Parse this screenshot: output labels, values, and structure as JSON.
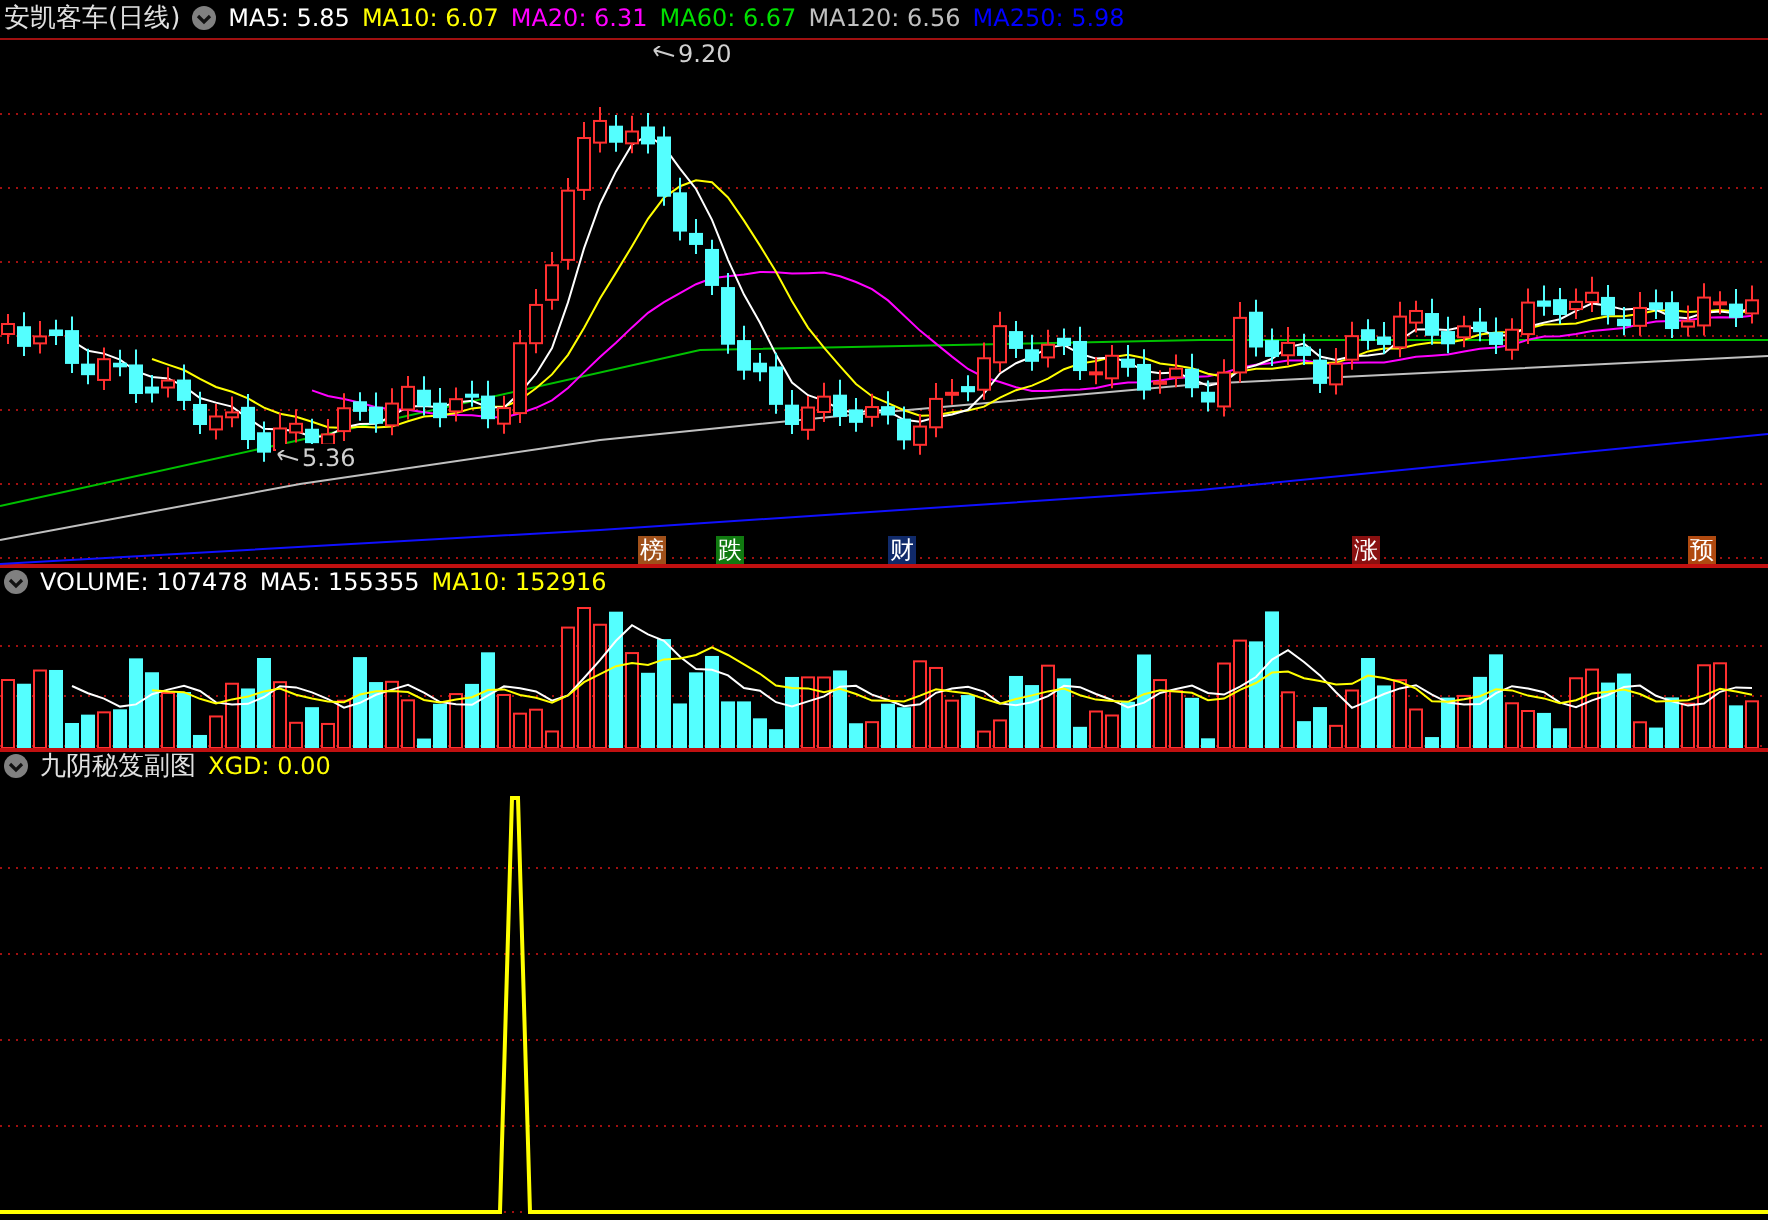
{
  "price_panel": {
    "title": "安凯客车(日线)",
    "legend": [
      {
        "label": "MA5: 5.85",
        "color": "#ffffff"
      },
      {
        "label": "MA10: 6.07",
        "color": "#ffff00"
      },
      {
        "label": "MA20: 6.31",
        "color": "#ff00ff"
      },
      {
        "label": "MA60: 6.67",
        "color": "#00e000"
      },
      {
        "label": "MA120: 6.56",
        "color": "#c0c0c0"
      },
      {
        "label": "MA250: 5.98",
        "color": "#0000ff"
      }
    ],
    "annotations": [
      {
        "kind": "high",
        "text": "9.20"
      },
      {
        "kind": "low",
        "text": "5.36"
      }
    ],
    "event_tags": [
      {
        "text": "榜",
        "color": "#a0501a"
      },
      {
        "text": "跌",
        "color": "#107a10"
      },
      {
        "text": "财",
        "color": "#102a6a"
      },
      {
        "text": "涨",
        "color": "#8a1010"
      },
      {
        "text": "预",
        "color": "#b04a10"
      }
    ]
  },
  "volume_panel": {
    "legend": [
      {
        "label": "VOLUME: 107478",
        "color": "#ffffff"
      },
      {
        "label": "MA5: 155355",
        "color": "#ffffff"
      },
      {
        "label": "MA10: 152916",
        "color": "#ffff00"
      }
    ]
  },
  "indicator_panel": {
    "title": "九阴秘笈副图",
    "legend": [
      {
        "label": "XGD: 0.00",
        "color": "#ffff00"
      }
    ]
  }
}
